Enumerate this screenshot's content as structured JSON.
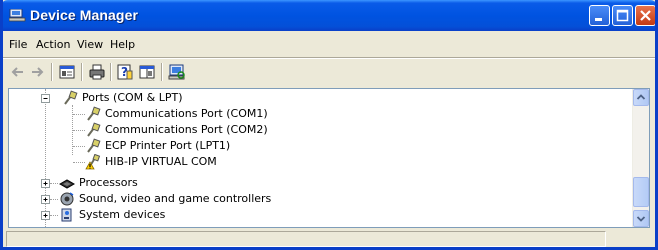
{
  "window": {
    "title": "Device Manager",
    "title_icon": "computer-icon"
  },
  "titlebar_buttons": {
    "minimize": "minimize-icon",
    "maximize": "maximize-icon",
    "close": "close-icon"
  },
  "menu": {
    "file": "File",
    "action": "Action",
    "view": "View",
    "help": "Help"
  },
  "toolbar": {
    "icons": [
      "back-arrow-icon",
      "forward-arrow-icon",
      "properties-pane-icon",
      "print-icon",
      "help-icon",
      "console-icon",
      "scan-hardware-icon"
    ]
  },
  "tree": {
    "ports": {
      "label": "Ports (COM & LPT)",
      "icon": "port-connector-icon",
      "children": [
        {
          "label": "Communications Port (COM1)",
          "icon": "port-connector-icon"
        },
        {
          "label": "Communications Port (COM2)",
          "icon": "port-connector-icon"
        },
        {
          "label": "ECP Printer Port (LPT1)",
          "icon": "port-connector-icon"
        },
        {
          "label": "HIB-IP VIRTUAL COM",
          "icon": "warning-port-icon"
        }
      ]
    },
    "collapsed": [
      {
        "label": "Processors",
        "icon": "processor-icon"
      },
      {
        "label": "Sound, video and game controllers",
        "icon": "speaker-icon"
      },
      {
        "label": "System devices",
        "icon": "system-device-icon"
      }
    ]
  },
  "colors": {
    "titlebar": "#0053e1",
    "frame": "#0a3fc8",
    "chrome": "#ece9d8",
    "close": "#c43a13"
  }
}
